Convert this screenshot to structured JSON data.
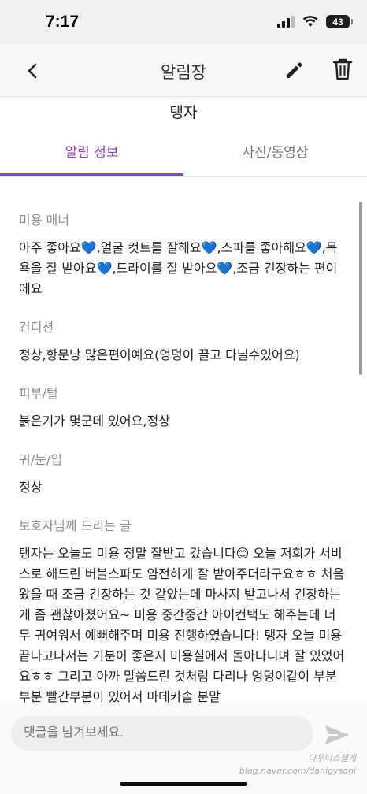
{
  "status_bar": {
    "time": "7:17",
    "battery": "43"
  },
  "header": {
    "title": "알림장"
  },
  "pet": {
    "name": "탱자"
  },
  "tabs": [
    {
      "label": "알림 정보"
    },
    {
      "label": "사진/동영상"
    }
  ],
  "sections": [
    {
      "label": "미용 매너",
      "text": "아주 좋아요💙,얼굴 컷트를 잘해요💙,스파를 좋아해요💙,목욕을 잘 받아요💙,드라이를 잘 받아요💙,조금 긴장하는 편이에요"
    },
    {
      "label": "컨디션",
      "text": "정상,항문낭 많은편이예요(엉덩이 끌고 다닐수있어요)"
    },
    {
      "label": "피부/털",
      "text": "붉은기가 몇군데 있어요,정상"
    },
    {
      "label": "귀/눈/입",
      "text": "정상"
    },
    {
      "label": "보호자님께 드리는 글",
      "text": "탱자는 오늘도 미용 정말 잘받고 갔습니다😊 오늘 저희가 서비스로 해드린 버블스파도 얌전하게 잘 받아주더라구요ㅎㅎ 처음 왔을 때 조금 긴장하는 것 같았는데 마사지 받고나서 긴장하는게 좀 괜찮아졌어요~ 미용 중간중간 아이컨택도 해주는데 너무 귀여워서 예뻐해주며 미용 진행하였습니다! 탱자 오늘 미용 끝나고나서는 기분이 좋은지 미용실에서 돌아다니며 잘 있었어요ㅎㅎ 그리고 아까 말씀드린 것처럼 다리나 엉덩이같이 부분부분 빨간부분이 있어서 마데카솔 분말"
    }
  ],
  "comment": {
    "placeholder": "댓글을 남겨보세요."
  },
  "watermark": {
    "line1": "다우니스챕게",
    "line2": "blog.naver.com/danigysoni"
  },
  "colors": {
    "accent": "#8a46c8",
    "heart": "#1e6fe0"
  }
}
